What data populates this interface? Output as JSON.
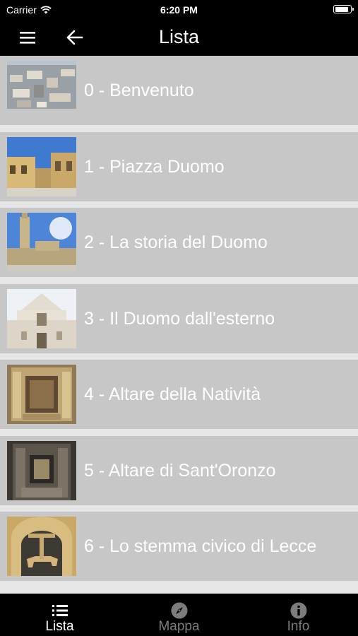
{
  "status_bar": {
    "carrier": "Carrier",
    "time": "6:20 PM",
    "battery_level": 0.9
  },
  "nav": {
    "title": "Lista",
    "menu_icon": "hamburger-menu-icon",
    "back_icon": "arrow-left-icon"
  },
  "list": {
    "items": [
      {
        "label": "0 - Benvenuto"
      },
      {
        "label": "1 - Piazza Duomo"
      },
      {
        "label": "2 - La storia del Duomo"
      },
      {
        "label": "3 - Il Duomo dall'esterno"
      },
      {
        "label": "4 - Altare della Natività"
      },
      {
        "label": "5 - Altare di Sant'Oronzo"
      },
      {
        "label": "6 - Lo stemma civico di Lecce"
      }
    ]
  },
  "tabs": [
    {
      "label": "Lista",
      "icon": "list-icon",
      "active": true
    },
    {
      "label": "Mappa",
      "icon": "compass-icon",
      "active": false
    },
    {
      "label": "Info",
      "icon": "info-icon",
      "active": false
    }
  ],
  "colors": {
    "bar_background": "#000000",
    "row_background": "#c7c7c7",
    "separator": "#e6e6e6",
    "active_tab": "#ffffff",
    "inactive_tab": "#7d7d7d"
  }
}
